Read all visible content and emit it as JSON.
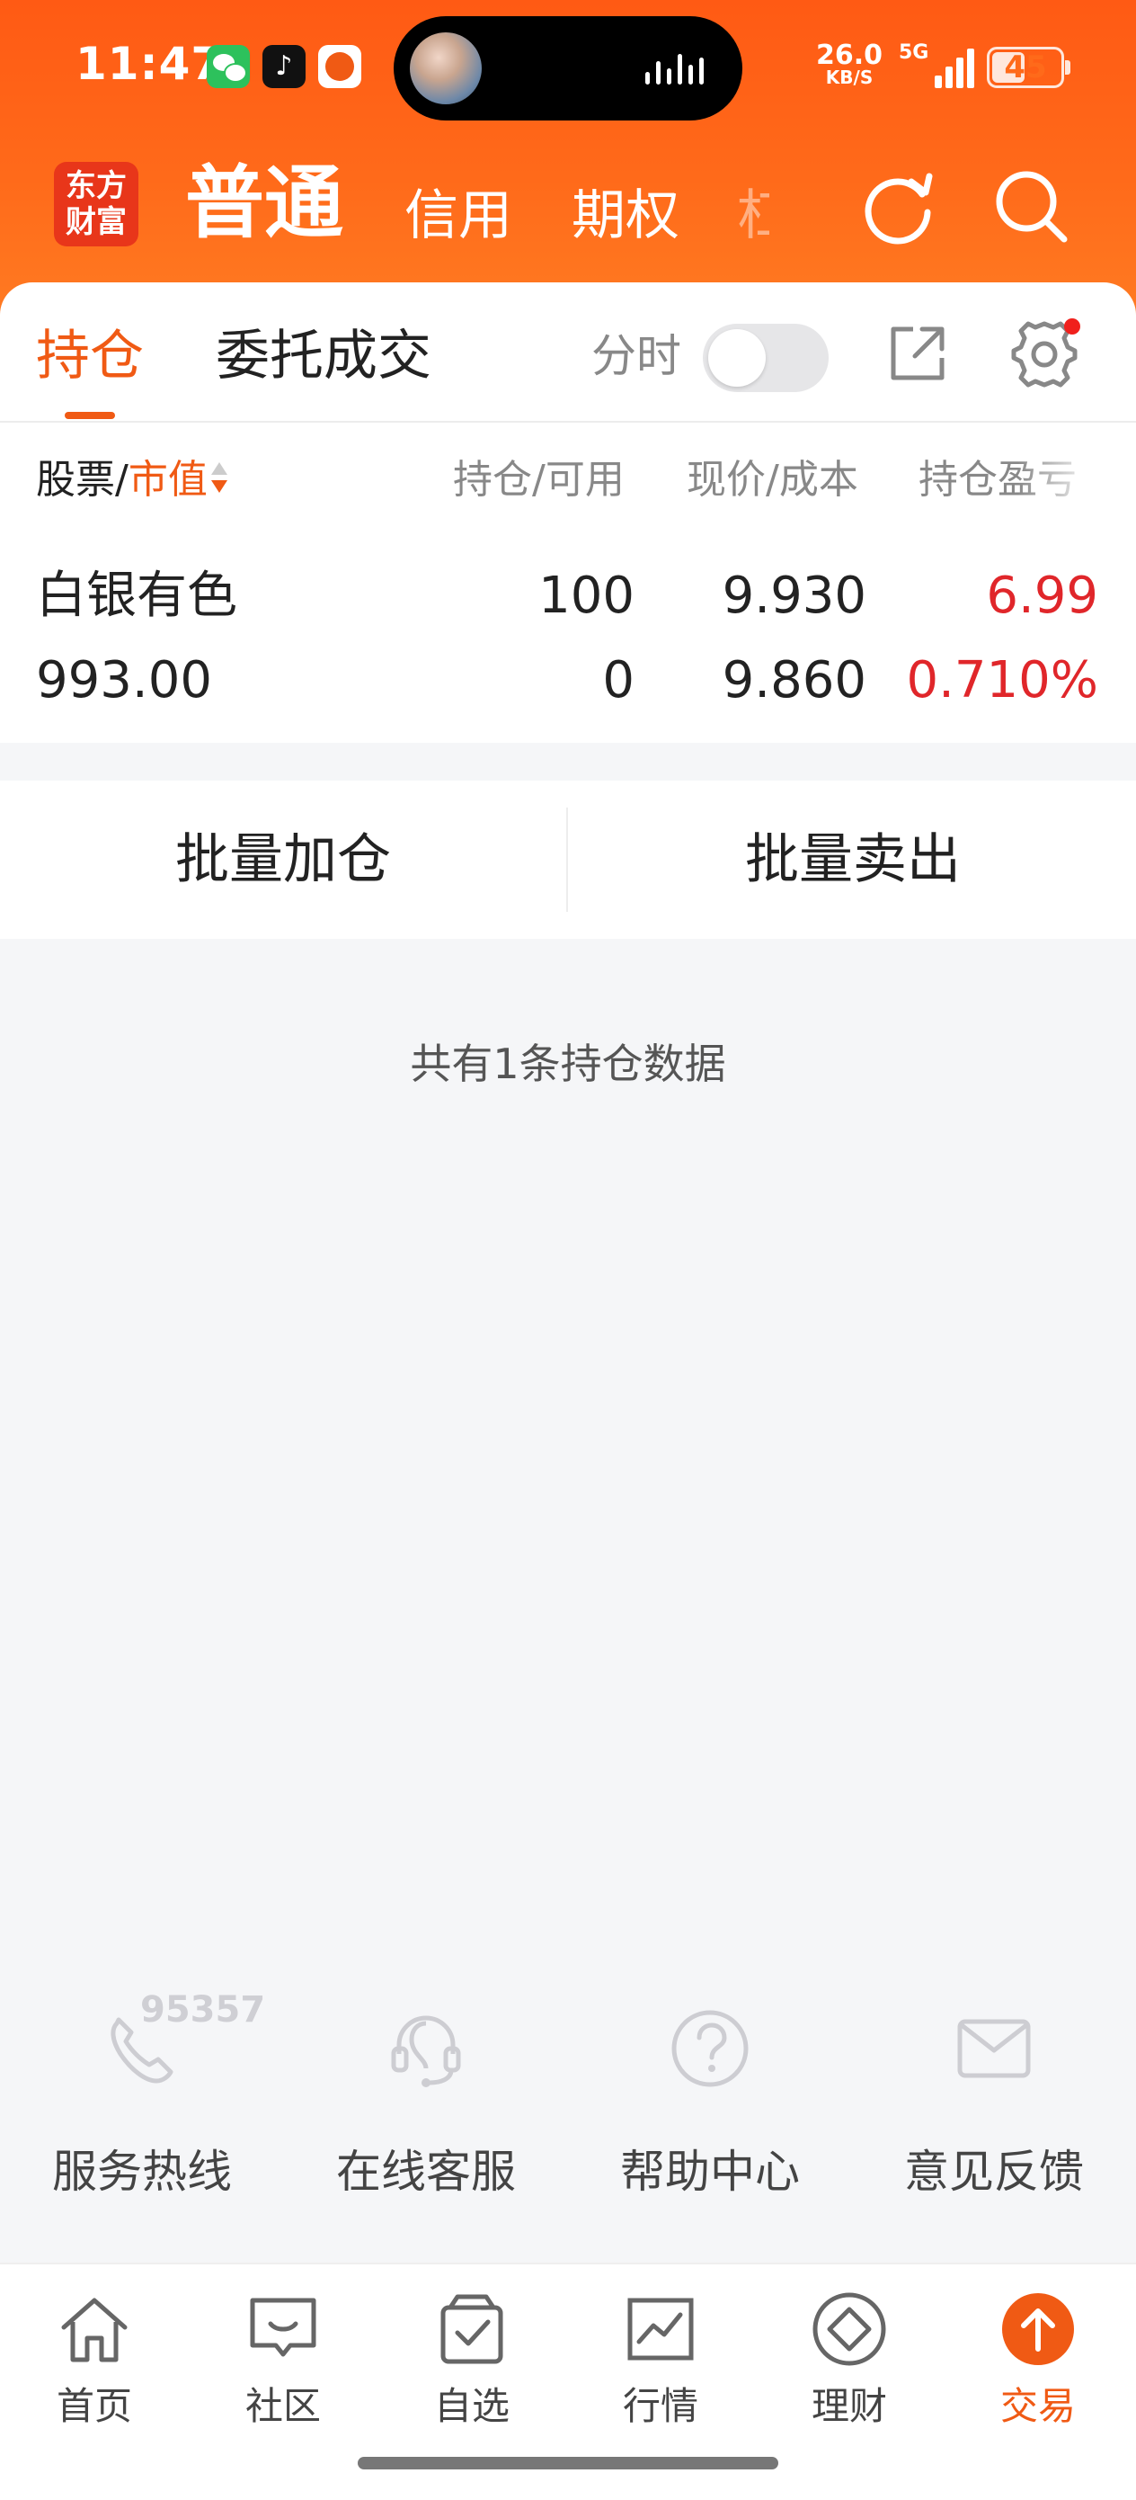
{
  "status_bar": {
    "time": "11:47",
    "net_speed": "26.0",
    "net_unit": "KB/S",
    "signal_label": "5G",
    "battery": "45"
  },
  "header": {
    "logo_text_top": "东方",
    "logo_text_bottom": "财富",
    "tabs": [
      "普通",
      "信用",
      "期权",
      "杠"
    ],
    "active_tab": "普通"
  },
  "subnav": {
    "tabs": [
      "持仓",
      "委托成交"
    ],
    "active_tab": "持仓",
    "toggle_label": "分时",
    "toggle_on": false
  },
  "table": {
    "headers": {
      "stock": "股票",
      "slash": "/",
      "market_value": "市值",
      "qty": "持仓/可用",
      "price": "现价/成本",
      "pl": "持仓盈亏"
    },
    "rows": [
      {
        "name": "白银有色",
        "market_value": "993.00",
        "holding": "100",
        "available": "0",
        "price": "9.930",
        "cost": "9.860",
        "pl": "6.99",
        "pl_pct": "0.710%"
      }
    ]
  },
  "batch": {
    "add_label": "批量加仓",
    "sell_label": "批量卖出"
  },
  "summary": {
    "text": "共有1条持仓数据"
  },
  "services": {
    "hotline_number": "95357",
    "items": [
      "服务热线",
      "在线客服",
      "帮助中心",
      "意见反馈"
    ]
  },
  "bottom_nav": {
    "items": [
      "首页",
      "社区",
      "自选",
      "行情",
      "理财",
      "交易"
    ],
    "active": "交易"
  },
  "colors": {
    "brand": "#f05a14",
    "header_gradient_top": "#ff5a14",
    "loss_gain_red": "#e0262a"
  }
}
